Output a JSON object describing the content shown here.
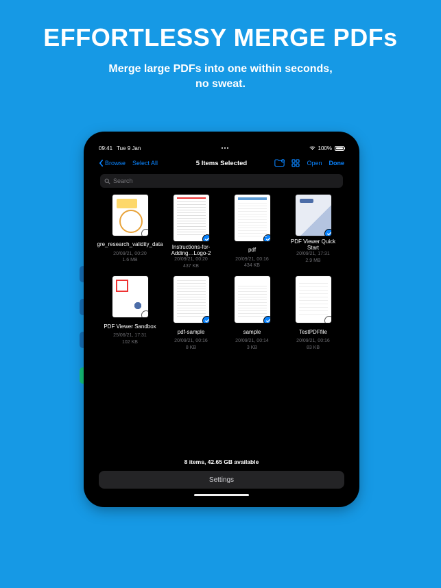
{
  "hero": {
    "title": "EFFORTLESSY MERGE PDFs",
    "subtitle_line1": "Merge large PDFs into one within seconds,",
    "subtitle_line2": "no sweat."
  },
  "status_bar": {
    "time": "09:41",
    "date": "Tue 9 Jan",
    "battery_pct": "100%"
  },
  "navbar": {
    "back_label": "Browse",
    "select_all_label": "Select All",
    "title": "5 Items Selected",
    "open_label": "Open",
    "done_label": "Done",
    "icons": {
      "folder": "folder-badge-icon",
      "grid": "grid-icon"
    }
  },
  "search": {
    "placeholder": "Search"
  },
  "files": [
    {
      "name": "gre_research_validity_data",
      "date": "20/09/21, 00:20",
      "size": "1.6 MB",
      "selected": false,
      "art": "art-a",
      "tall": false
    },
    {
      "name": "Instructions-for-Adding…Logo-2",
      "date": "20/09/21, 00:20",
      "size": "437 KB",
      "selected": true,
      "art": "art-b",
      "tall": true
    },
    {
      "name": "pdf",
      "date": "20/09/21, 00:16",
      "size": "434 KB",
      "selected": true,
      "art": "art-c",
      "tall": true
    },
    {
      "name": "PDF Viewer Quick Start",
      "date": "20/09/21, 17:31",
      "size": "2.9 MB",
      "selected": true,
      "art": "art-d",
      "tall": false
    },
    {
      "name": "PDF Viewer Sandbox",
      "date": "25/06/21, 17:31",
      "size": "102 KB",
      "selected": false,
      "art": "art-e",
      "tall": false
    },
    {
      "name": "pdf-sample",
      "date": "20/09/21, 00:16",
      "size": "8 KB",
      "selected": true,
      "art": "art-f",
      "tall": true
    },
    {
      "name": "sample",
      "date": "20/09/21, 00:14",
      "size": "3 KB",
      "selected": true,
      "art": "art-g",
      "tall": true
    },
    {
      "name": "TestPDFfile",
      "date": "20/09/21, 00:16",
      "size": "83 KB",
      "selected": false,
      "art": "art-h",
      "tall": true
    }
  ],
  "footer": {
    "status": "8 items, 42.65 GB available",
    "settings_label": "Settings"
  }
}
